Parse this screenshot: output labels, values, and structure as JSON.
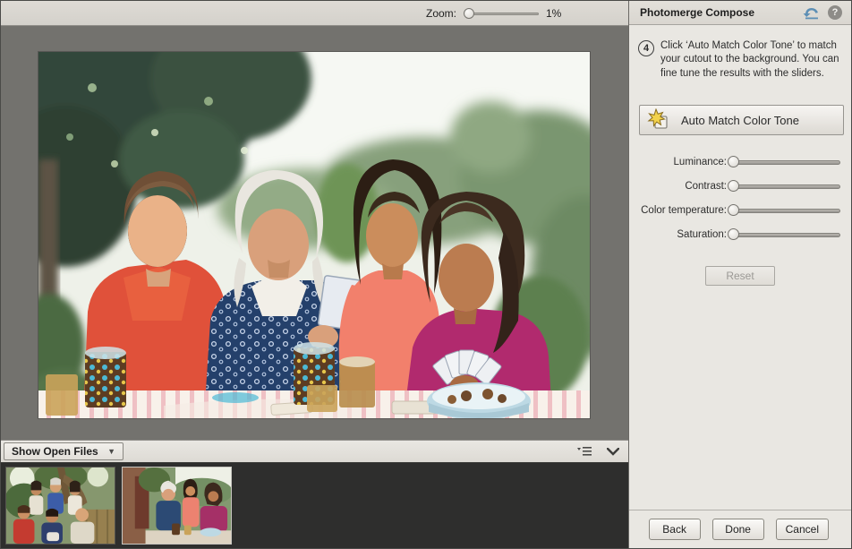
{
  "toolbar": {
    "zoom_label": "Zoom:",
    "zoom_value": "1%"
  },
  "panel": {
    "title": "Photomerge Compose",
    "step_number": "4",
    "instruction": "Click ‘Auto Match Color Tone’ to match your cutout to the background. You can fine tune the results with the sliders.",
    "auto_match_label": "Auto Match Color Tone",
    "sliders": [
      {
        "label": "Luminance:"
      },
      {
        "label": "Contrast:"
      },
      {
        "label": "Color temperature:"
      },
      {
        "label": "Saturation:"
      }
    ],
    "reset_label": "Reset",
    "footer": {
      "back_label": "Back",
      "done_label": "Done",
      "cancel_label": "Cancel"
    },
    "icons": [
      "undo-icon",
      "help-icon"
    ]
  },
  "photobin": {
    "dropdown_label": "Show Open Files",
    "thumbnail_count": 2,
    "icons": [
      "panel-menu-icon",
      "chevron-down-icon"
    ]
  },
  "colors": {
    "panel_bg": "#e9e7e2",
    "toolbar_bg": "#d9d6d0",
    "canvas_bg": "#73726e",
    "photobin_bg": "#2e2e2d",
    "undo_icon_blue": "#5d8fb5",
    "auto_match_star_yellow": "#f2d24b"
  }
}
